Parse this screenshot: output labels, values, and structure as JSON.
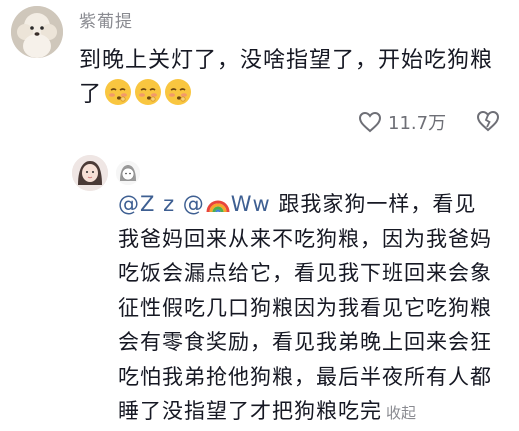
{
  "comment": {
    "username": "紫葡提",
    "text": "到晚上关灯了，没啥指望了，开始吃狗粮了",
    "emoji": [
      "pleading-face-emoji",
      "pleading-face-emoji",
      "pleading-face-emoji"
    ],
    "like_count": "11.7万"
  },
  "reply": {
    "mention_1": "@Z",
    "mention_2": "z @",
    "mention_2_suffix": "Ww",
    "line_1": "跟我家狗一样，看见",
    "line_2": "我爸妈回来从来不吃狗粮，因为我爸妈",
    "line_3": "吃饭会漏点给它，看见我下班回来会象",
    "line_4": "征性假吃几口狗粮因为我看见它吃狗粮",
    "line_5": "会有零食奖励，看见我弟晚上回来会狂",
    "line_6": "吃怕我弟抢他狗粮，最后半夜所有人都",
    "line_7": "睡了没指望了才把狗粮吃完",
    "collapse_label": "收起"
  },
  "colors": {
    "mention": "#3e5f92",
    "muted": "#8a8b91",
    "text": "#161823"
  }
}
